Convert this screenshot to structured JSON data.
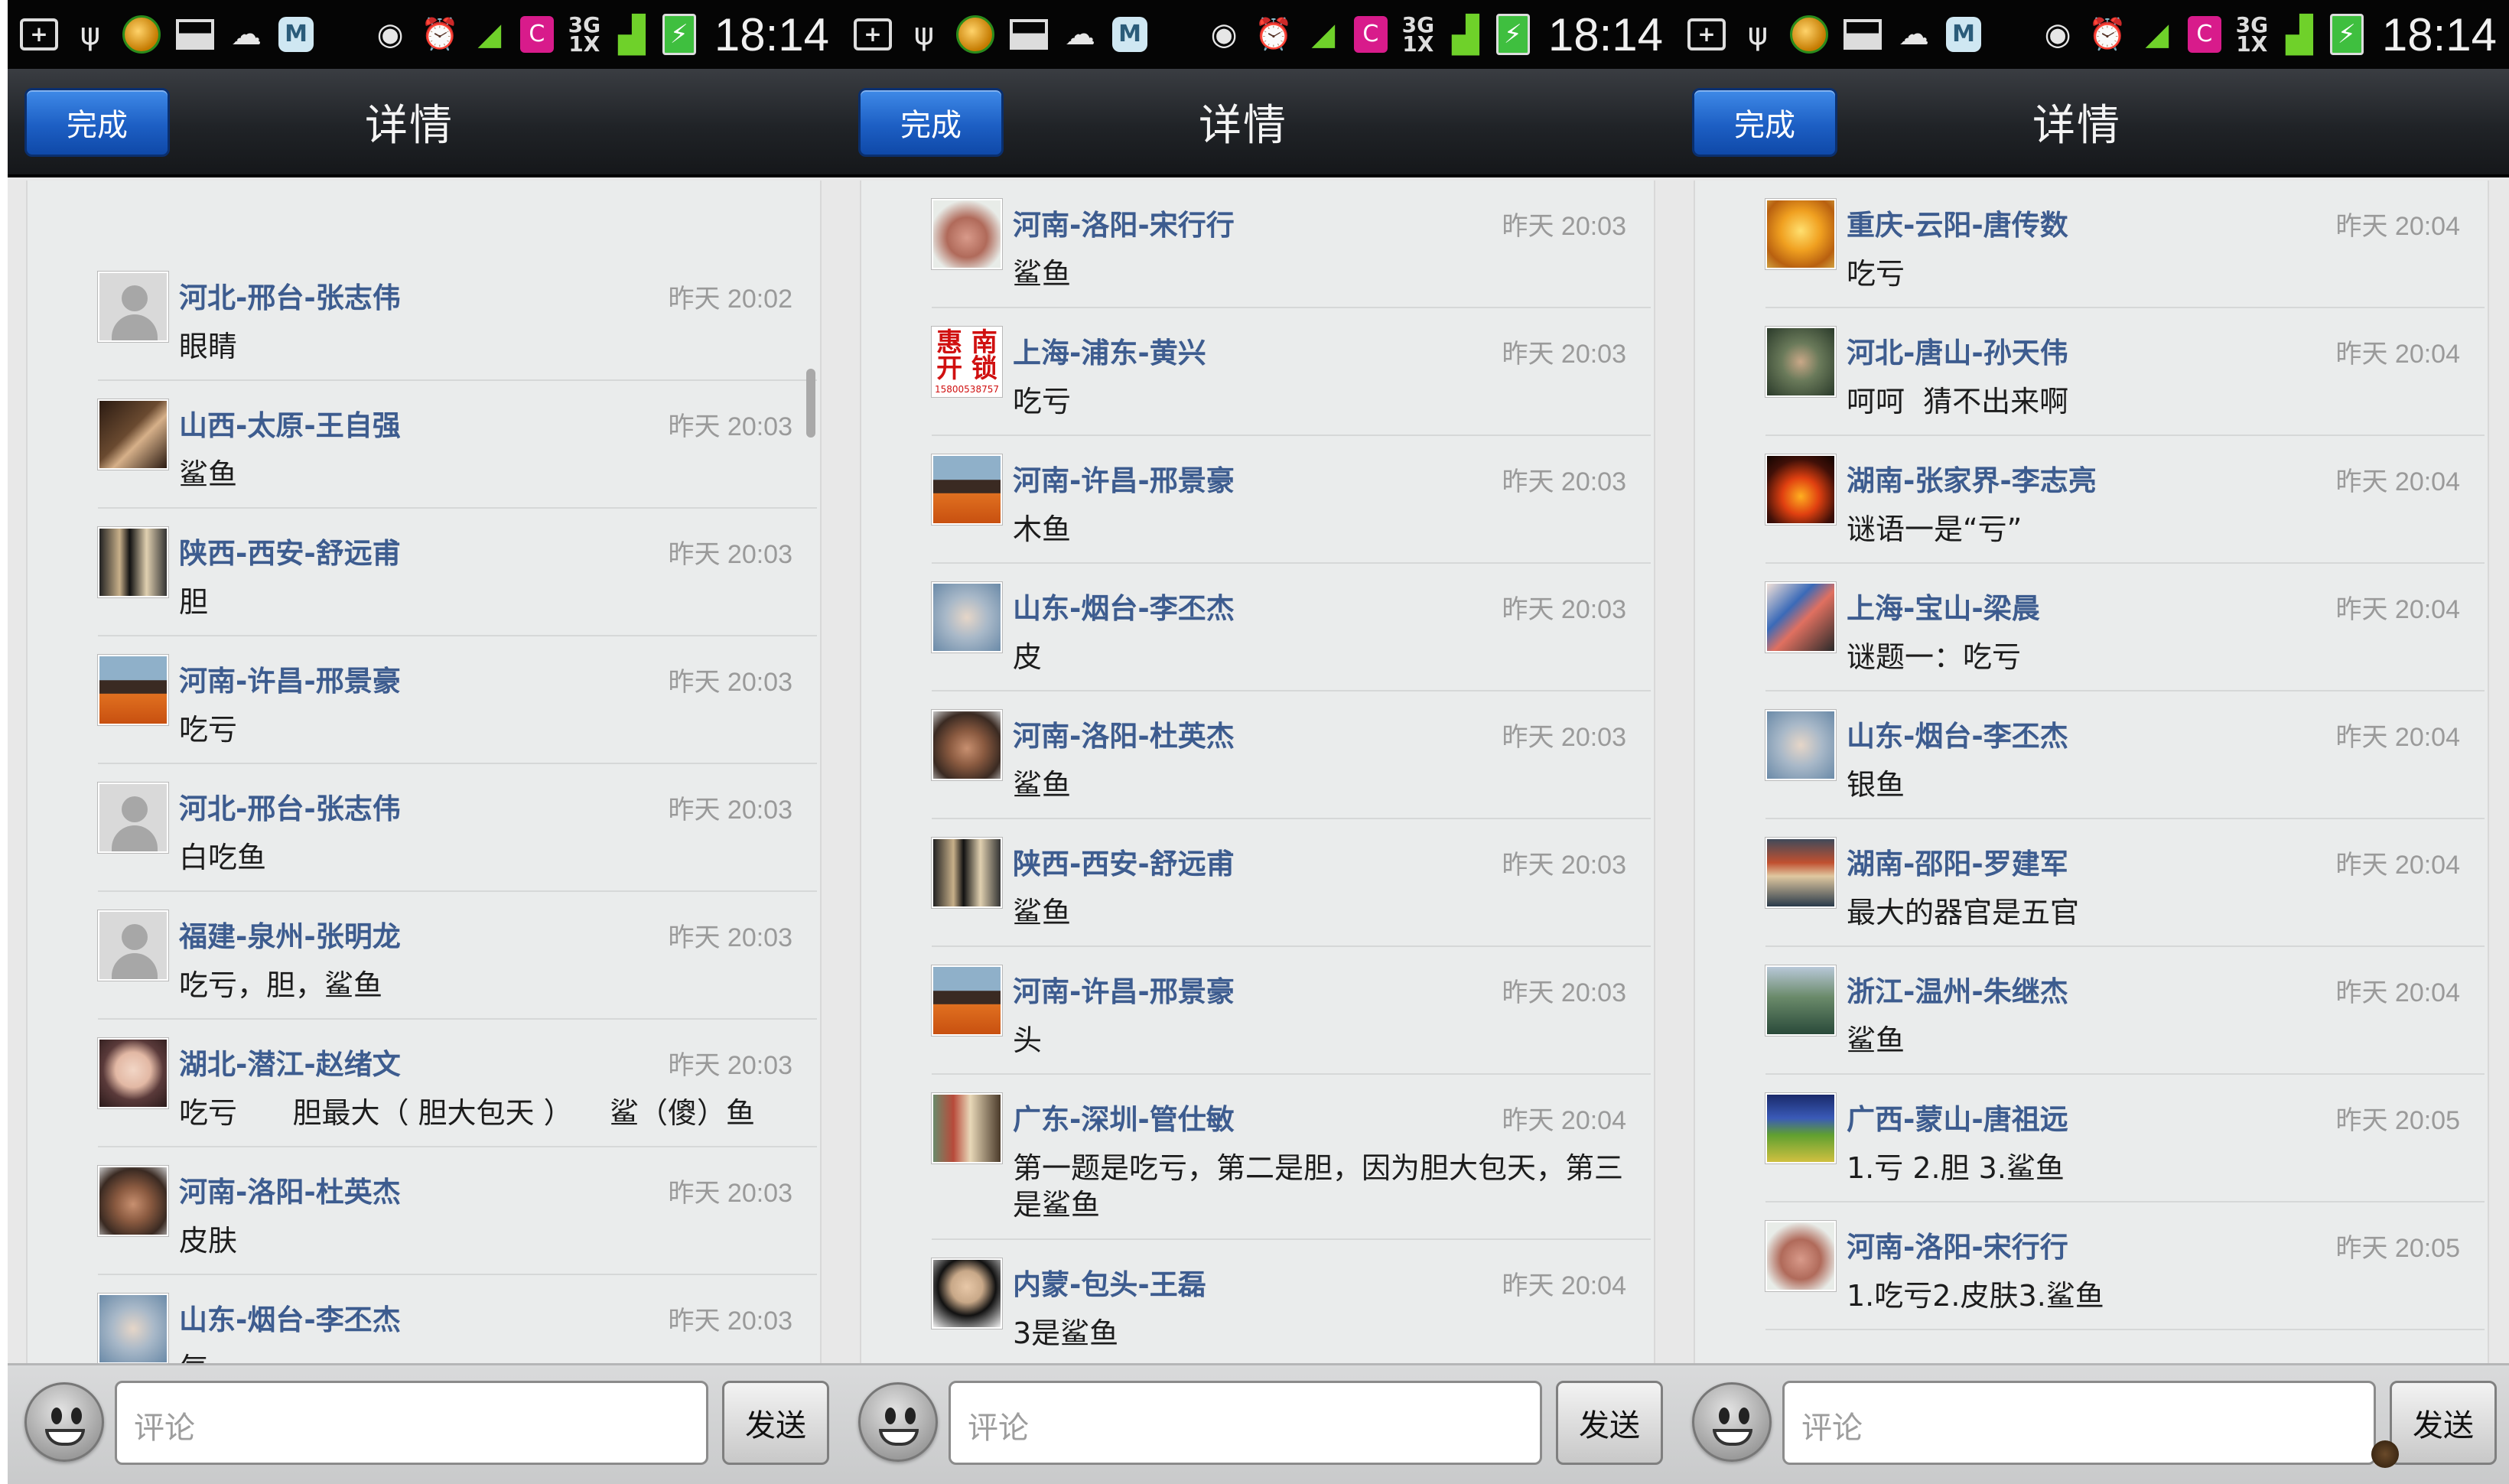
{
  "status_bar": {
    "time": "18:14",
    "network": "3G",
    "network_sub": "1X"
  },
  "header": {
    "done_label": "完成",
    "title": "详情"
  },
  "input": {
    "placeholder": "评论",
    "send_label": "发送"
  },
  "colors": {
    "name": "#3d5c8f",
    "time": "#9a9a9a",
    "done_button": "#1d5fc4",
    "titlebar": "#202327",
    "status_bar": "#050505"
  },
  "panels": [
    {
      "rows": [
        {
          "name": "",
          "time": "",
          "message": "",
          "avatar": "default"
        },
        {
          "name": "河北-邢台-张志伟",
          "time": "昨天 20:02",
          "message": "眼睛",
          "avatar": "default"
        },
        {
          "name": "山西-太原-王自强",
          "time": "昨天 20:03",
          "message": "鲨鱼",
          "avatar": "photo-dark-room"
        },
        {
          "name": "陕西-西安-舒远甫",
          "time": "昨天 20:03",
          "message": "胆",
          "avatar": "photo-posters"
        },
        {
          "name": "河南-许昌-邢景豪",
          "time": "昨天 20:03",
          "message": "吃亏",
          "avatar": "photo-man-orange"
        },
        {
          "name": "河北-邢台-张志伟",
          "time": "昨天 20:03",
          "message": "白吃鱼",
          "avatar": "default"
        },
        {
          "name": "福建-泉州-张明龙",
          "time": "昨天 20:03",
          "message": "吃亏，胆，鲨鱼",
          "avatar": "default"
        },
        {
          "name": "湖北-潜江-赵绪文",
          "time": "昨天 20:03",
          "message": "吃亏      胆最大（ 胆大包天 ）    鲨（傻）鱼",
          "avatar": "photo-girl"
        },
        {
          "name": "河南-洛阳-杜英杰",
          "time": "昨天 20:03",
          "message": "皮肤",
          "avatar": "photo-man-dark"
        },
        {
          "name": "山东-烟台-李丕杰",
          "time": "昨天 20:03",
          "message": "气",
          "avatar": "photo-man-light"
        }
      ]
    },
    {
      "rows": [
        {
          "name": "河南-洛阳-宋行行",
          "time": "昨天 20:03",
          "message": "鲨鱼",
          "avatar": "photo-man-pink"
        },
        {
          "name": "上海-浦东-黄兴",
          "time": "昨天 20:03",
          "message": "吃亏",
          "avatar": "text-sign",
          "avatar_text": "惠 南\n开 锁",
          "avatar_subtext": "15800538757"
        },
        {
          "name": "河南-许昌-邢景豪",
          "time": "昨天 20:03",
          "message": "木鱼",
          "avatar": "photo-man-orange"
        },
        {
          "name": "山东-烟台-李丕杰",
          "time": "昨天 20:03",
          "message": "皮",
          "avatar": "photo-man-light"
        },
        {
          "name": "河南-洛阳-杜英杰",
          "time": "昨天 20:03",
          "message": "鲨鱼",
          "avatar": "photo-man-dark"
        },
        {
          "name": "陕西-西安-舒远甫",
          "time": "昨天 20:03",
          "message": "鲨鱼",
          "avatar": "photo-posters"
        },
        {
          "name": "河南-许昌-邢景豪",
          "time": "昨天 20:03",
          "message": "头",
          "avatar": "photo-man-orange"
        },
        {
          "name": "广东-深圳-管仕敏",
          "time": "昨天 20:04",
          "message": "第一题是吃亏，第二是胆，因为胆大包天，第三是鲨鱼",
          "avatar": "photo-shopfront"
        },
        {
          "name": "内蒙-包头-王磊",
          "time": "昨天 20:04",
          "message": "3是鲨鱼",
          "avatar": "photo-man-suit"
        }
      ]
    },
    {
      "rows": [
        {
          "name": "重庆-云阳-唐传数",
          "time": "昨天 20:04",
          "message": "吃亏",
          "avatar": "photo-buddha"
        },
        {
          "name": "河北-唐山-孙天伟",
          "time": "昨天 20:04",
          "message": "呵呵  猜不出来啊",
          "avatar": "photo-man-green"
        },
        {
          "name": "湖南-张家界-李志亮",
          "time": "昨天 20:04",
          "message": "谜语一是“亏”",
          "avatar": "photo-fire"
        },
        {
          "name": "上海-宝山-梁晨",
          "time": "昨天 20:04",
          "message": "谜题一：吃亏",
          "avatar": "photo-couple"
        },
        {
          "name": "山东-烟台-李丕杰",
          "time": "昨天 20:04",
          "message": "银鱼",
          "avatar": "photo-man-light"
        },
        {
          "name": "湖南-邵阳-罗建军",
          "time": "昨天 20:04",
          "message": "最大的器官是五官",
          "avatar": "photo-street"
        },
        {
          "name": "浙江-温州-朱继杰",
          "time": "昨天 20:04",
          "message": "鲨鱼",
          "avatar": "photo-landscape"
        },
        {
          "name": "广西-蒙山-唐祖远",
          "time": "昨天 20:05",
          "message": "1.亏 2.胆 3.鲨鱼",
          "avatar": "photo-field"
        },
        {
          "name": "河南-洛阳-宋行行",
          "time": "昨天 20:05",
          "message": "1.吃亏2.皮肤3.鲨鱼",
          "avatar": "photo-man-pink"
        }
      ]
    }
  ]
}
